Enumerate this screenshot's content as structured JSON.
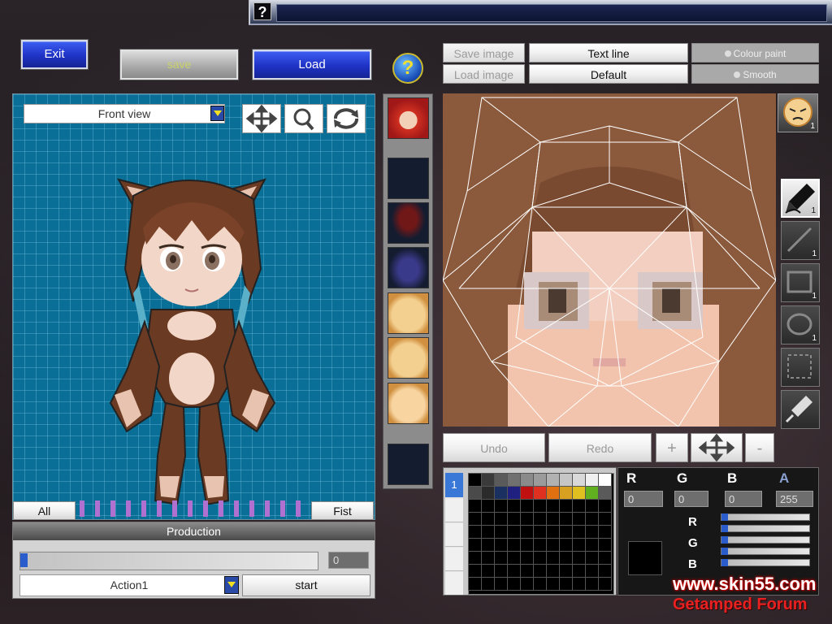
{
  "header": {
    "help_glyph": "?"
  },
  "toolbar": {
    "exit_label": "Exit",
    "save_label": "save",
    "load_label": "Load",
    "help_label": "?"
  },
  "image_panel": {
    "save_image_label": "Save image",
    "load_image_label": "Load image",
    "text_line_label": "Text line",
    "default_label": "Default",
    "colour_paint_label": "Colour paint",
    "smooth_label": "Smooth"
  },
  "viewer": {
    "view_select_value": "Front view",
    "move_icon": "move-icon",
    "zoom_icon": "magnifier-icon",
    "rotate_icon": "rotate-icon"
  },
  "timeline": {
    "all_label": "All",
    "fist_label": "Fist"
  },
  "production": {
    "title": "Production",
    "frame_value": "0",
    "action_select_value": "Action1",
    "start_label": "start"
  },
  "editor": {
    "undo_label": "Undo",
    "redo_label": "Redo",
    "zoom_in_label": "+",
    "zoom_out_label": "-",
    "face_badge": "1",
    "pen_badge": "1",
    "line_badge": "1",
    "rect_badge": "1",
    "ellipse_badge": "1"
  },
  "color": {
    "layer_tab": "1",
    "r_label": "R",
    "g_label": "G",
    "b_label": "B",
    "a_label": "A",
    "r_value": "0",
    "g_value": "0",
    "b_value": "0",
    "a_value": "255",
    "current_color": "#000000",
    "swatches": [
      "#000000",
      "#3a3a3a",
      "#5a5a5a",
      "#707070",
      "#8a8a8a",
      "#9b9b9b",
      "#b1b1b1",
      "#c6c6c6",
      "#d9d9d9",
      "#f0f0f0",
      "#ffffff",
      "#4a4a4a",
      "#2b2b2b",
      "#1a3060",
      "#202080",
      "#c01010",
      "#e03020",
      "#e07010",
      "#d8a020",
      "#e0c020",
      "#60b020",
      "#5a5a5a"
    ]
  },
  "watermark": {
    "site": "www.skin55.com",
    "forum": "Getamped Forum"
  }
}
